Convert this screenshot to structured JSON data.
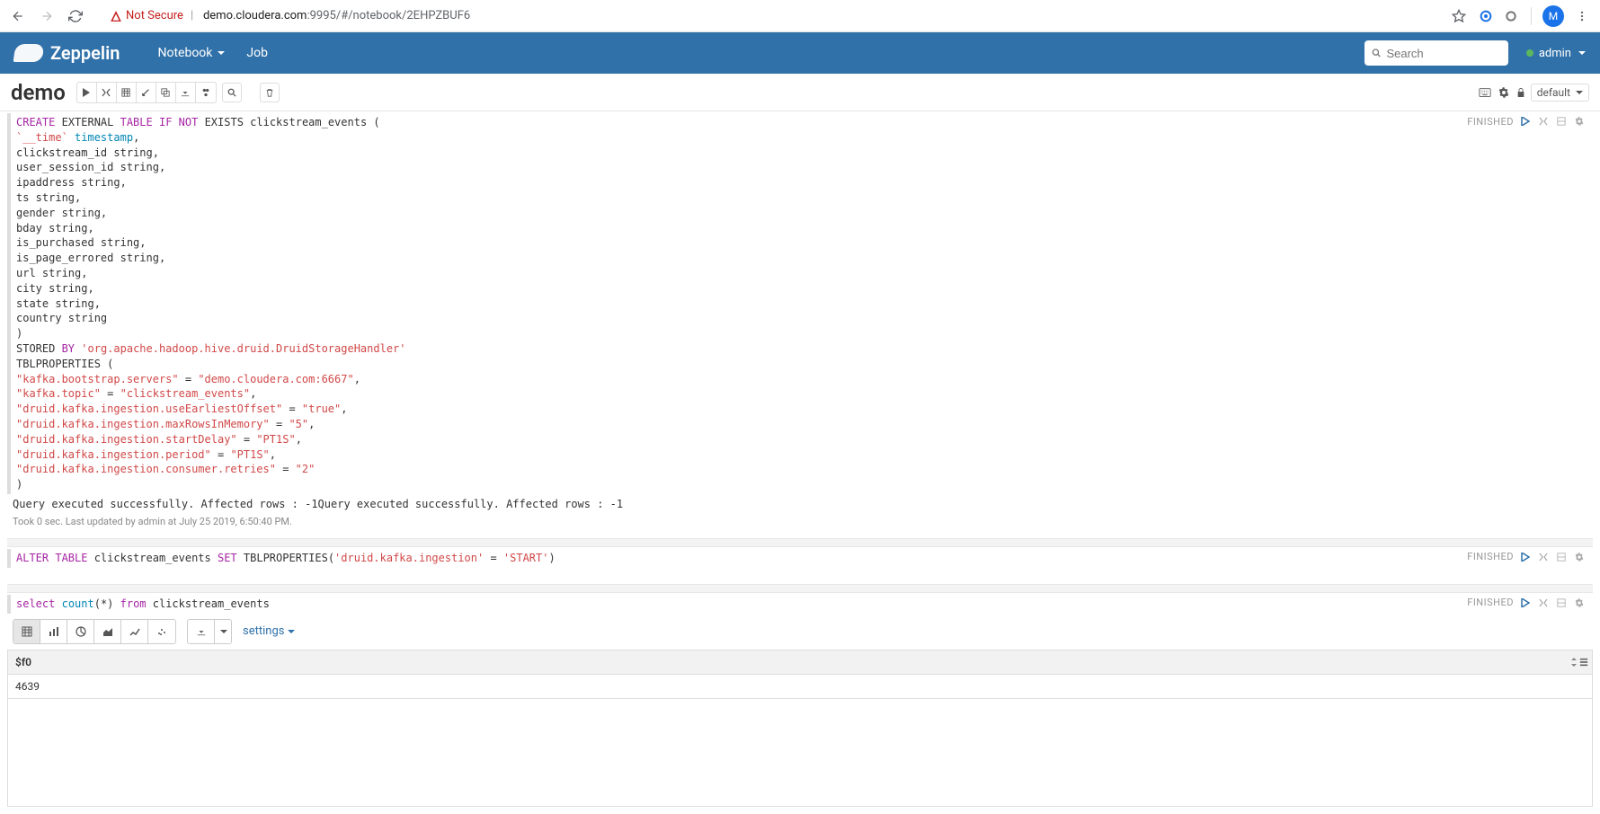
{
  "browser": {
    "security_label": "Not Secure",
    "url_display_prefix": "demo.cloudera.com",
    "url_display_suffix": ":9995/#/notebook/2EHPZBUF6",
    "avatar_letter": "M"
  },
  "header": {
    "brand": "Zeppelin",
    "nav_notebook": "Notebook",
    "nav_job": "Job",
    "search_placeholder": "Search",
    "user": "admin"
  },
  "toolbar": {
    "title": "demo",
    "mode_label": "default"
  },
  "paragraphs": {
    "p1": {
      "status": "FINISHED",
      "result": "Query executed successfully. Affected rows : -1Query executed successfully. Affected rows : -1",
      "meta": "Took 0 sec. Last updated by admin at July 25 2019, 6:50:40 PM."
    },
    "p2": {
      "status": "FINISHED"
    },
    "p3": {
      "status": "FINISHED",
      "settings_label": "settings",
      "col_header": "$f0",
      "cell_value": "4639"
    }
  }
}
